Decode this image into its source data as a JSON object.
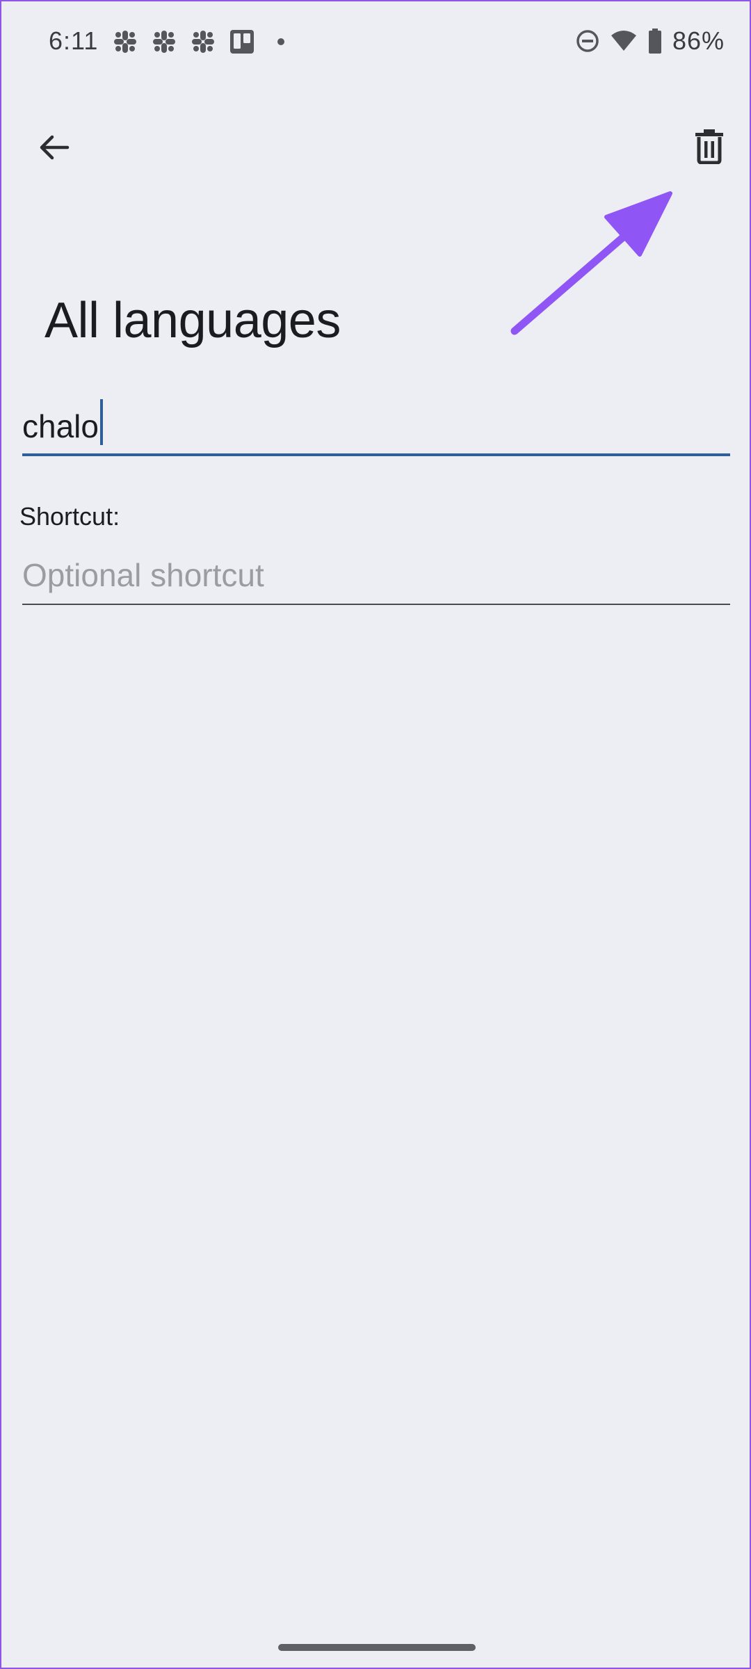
{
  "status_bar": {
    "time": "6:11",
    "notification_icons": [
      "slack-icon",
      "slack-icon",
      "slack-icon",
      "trello-icon",
      "dot-icon"
    ],
    "system_icons": [
      "do-not-disturb-icon",
      "wifi-icon",
      "battery-icon"
    ],
    "battery": "86%"
  },
  "app_bar": {
    "back_icon": "arrow-back-icon",
    "delete_icon": "trash-icon"
  },
  "page": {
    "title": "All languages"
  },
  "word_field": {
    "value": "chalo"
  },
  "shortcut": {
    "label": "Shortcut:",
    "placeholder": "Optional shortcut",
    "value": ""
  },
  "colors": {
    "background": "#edeef4",
    "accent": "#2f5f96",
    "annotation": "#8f55f5"
  }
}
